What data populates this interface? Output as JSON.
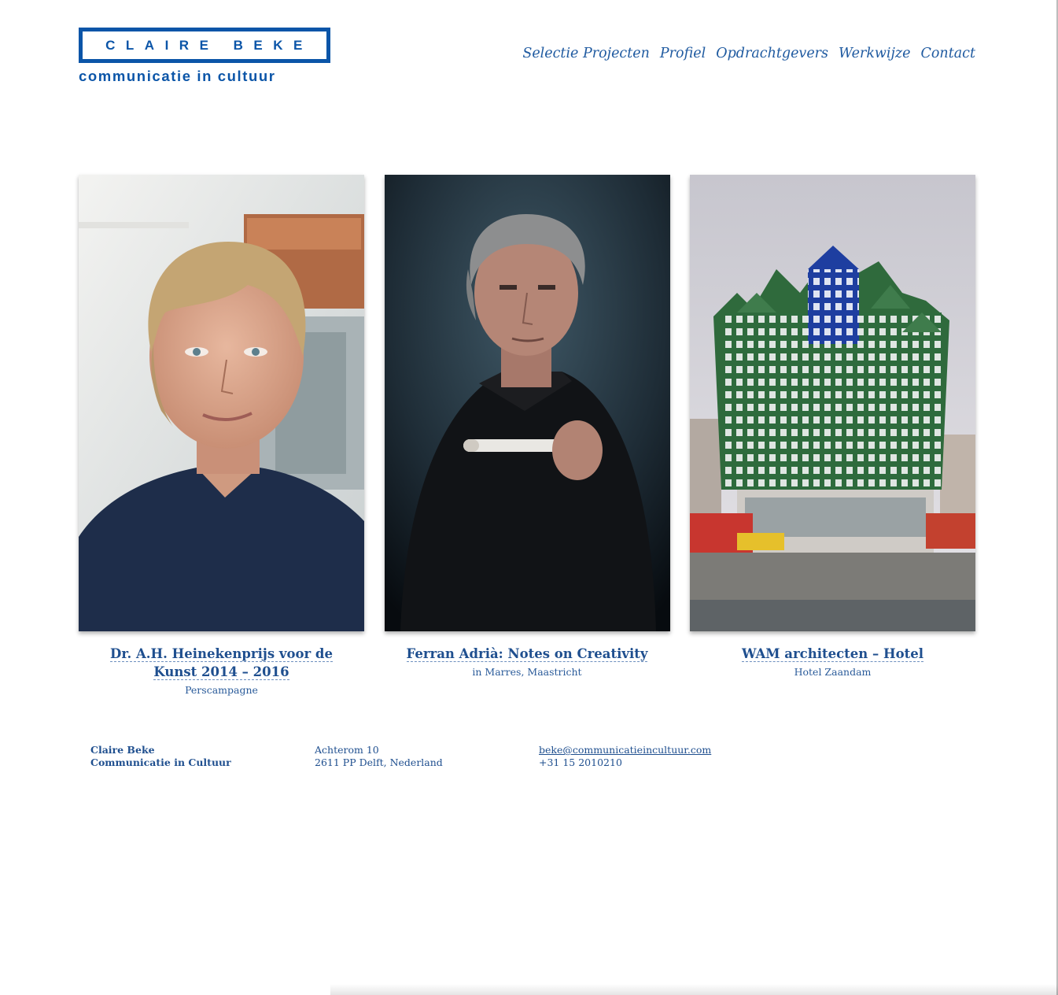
{
  "brand": {
    "name": "CLAIRE BEKE",
    "tagline": "communicatie in cultuur"
  },
  "nav": {
    "items": [
      "Selectie Projecten",
      "Profiel",
      "Opdrachtgevers",
      "Werkwijze",
      "Contact"
    ]
  },
  "projects": [
    {
      "title": "Dr. A.H. Heinekenprijs voor de Kunst 2014 – 2016",
      "subtitle": "Perscampagne"
    },
    {
      "title": "Ferran Adrià: Notes on Creativity",
      "subtitle": "in Marres, Maastricht"
    },
    {
      "title": "WAM architecten – Hotel",
      "subtitle": "Hotel Zaandam"
    }
  ],
  "footer": {
    "company_line1": "Claire Beke",
    "company_line2": "Communicatie in Cultuur",
    "address_line1": "Achterom 10",
    "address_line2": "2611 PP Delft, Nederland",
    "email": "beke@communicatieincultuur.com",
    "phone": "+31 15 2010210"
  },
  "colors": {
    "brand_blue": "#0b55a8",
    "text_blue": "#1f4f8f"
  }
}
